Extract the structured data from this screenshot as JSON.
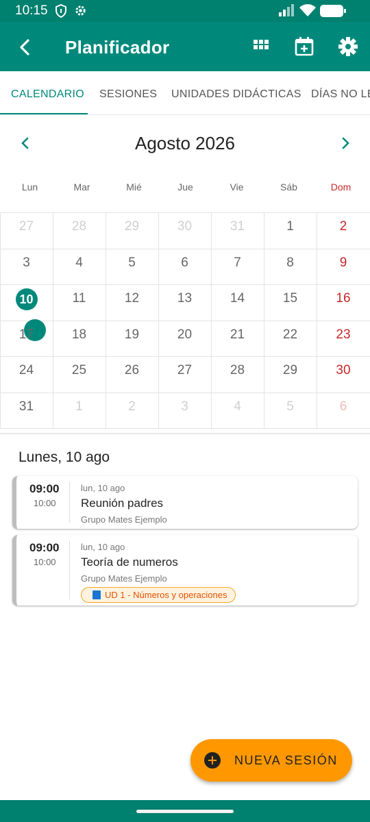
{
  "status_bar": {
    "time": "10:15",
    "left_icons": [
      "shield-icon",
      "gear-icon"
    ],
    "right_icons": [
      "signal-icon",
      "wifi-icon",
      "battery-icon"
    ]
  },
  "app_bar": {
    "title": "Planificador",
    "back_icon": "back-arrow-icon",
    "actions": [
      "grid-view-icon",
      "calendar-add-icon",
      "settings-icon"
    ],
    "color": "#00897b"
  },
  "tabs": {
    "items": [
      "CALENDARIO",
      "SESIONES",
      "UNIDADES DIDÁCTICAS",
      "DÍAS NO LECTIVOS"
    ],
    "active_index": 0,
    "accent_color": "#00897b"
  },
  "calendar": {
    "month_title": "Agosto 2026",
    "prev_icon": "chevron-left-icon",
    "next_icon": "chevron-right-icon",
    "weekdays": [
      "Lun",
      "Mar",
      "Mié",
      "Jue",
      "Vie",
      "Sáb",
      "Dom"
    ],
    "weeks": [
      [
        {
          "d": "27",
          "m": true
        },
        {
          "d": "28",
          "m": true
        },
        {
          "d": "29",
          "m": true
        },
        {
          "d": "30",
          "m": true
        },
        {
          "d": "31",
          "m": true
        },
        {
          "d": "1"
        },
        {
          "d": "2"
        }
      ],
      [
        {
          "d": "3"
        },
        {
          "d": "4"
        },
        {
          "d": "5"
        },
        {
          "d": "6"
        },
        {
          "d": "7"
        },
        {
          "d": "8"
        },
        {
          "d": "9"
        }
      ],
      [
        {
          "d": "10",
          "today": true,
          "event": true
        },
        {
          "d": "11"
        },
        {
          "d": "12"
        },
        {
          "d": "13"
        },
        {
          "d": "14"
        },
        {
          "d": "15"
        },
        {
          "d": "16"
        }
      ],
      [
        {
          "d": "17"
        },
        {
          "d": "18"
        },
        {
          "d": "19"
        },
        {
          "d": "20"
        },
        {
          "d": "21"
        },
        {
          "d": "22"
        },
        {
          "d": "23"
        }
      ],
      [
        {
          "d": "24"
        },
        {
          "d": "25"
        },
        {
          "d": "26"
        },
        {
          "d": "27"
        },
        {
          "d": "28"
        },
        {
          "d": "29"
        },
        {
          "d": "30"
        }
      ],
      [
        {
          "d": "31"
        },
        {
          "d": "1",
          "m": true
        },
        {
          "d": "2",
          "m": true
        },
        {
          "d": "3",
          "m": true
        },
        {
          "d": "4",
          "m": true
        },
        {
          "d": "5",
          "m": true
        },
        {
          "d": "6",
          "m": true
        }
      ]
    ],
    "weekend_color": "#c62828",
    "today_color": "#00897b"
  },
  "day_agenda": {
    "header": "Lunes, 10 ago",
    "sessions": [
      {
        "start": "09:00",
        "end": "10:00",
        "date": "lun, 10 ago",
        "title": "Reunión padres",
        "group": "Grupo Mates Ejemplo",
        "unit": ""
      },
      {
        "start": "09:00",
        "end": "10:00",
        "date": "lun, 10 ago",
        "title": "Teoría de numeros",
        "group": "Grupo Mates Ejemplo",
        "unit": "UD 1 - Números y operaciones"
      }
    ]
  },
  "fab": {
    "label": "NUEVA SESIÓN",
    "icon": "add-circle-icon",
    "color": "#ff9800"
  }
}
